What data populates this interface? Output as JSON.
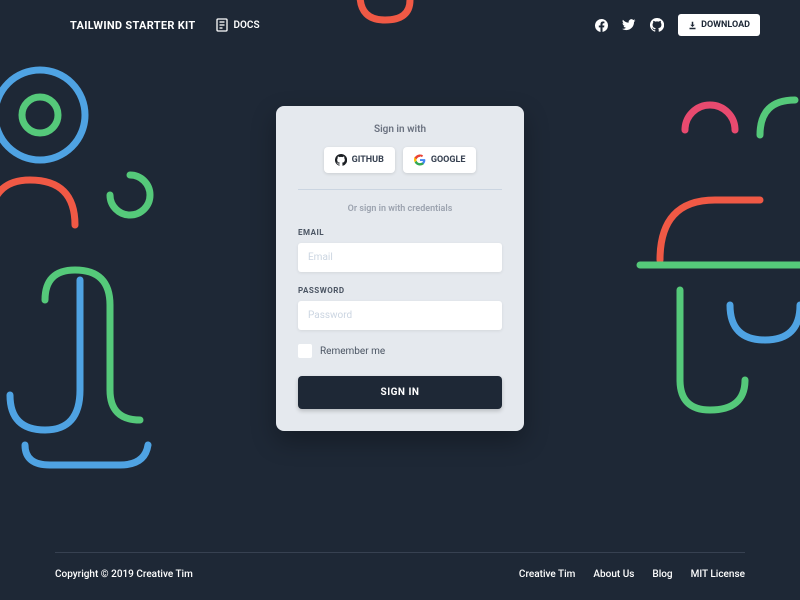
{
  "nav": {
    "brand": "TAILWIND STARTER KIT",
    "docs": "DOCS",
    "download": "DOWNLOAD"
  },
  "card": {
    "signin_with": "Sign in with",
    "github_btn": "GITHUB",
    "google_btn": "GOOGLE",
    "or_text": "Or sign in with credentials",
    "email_label": "EMAIL",
    "email_placeholder": "Email",
    "password_label": "PASSWORD",
    "password_placeholder": "Password",
    "remember_label": "Remember me",
    "signin_btn": "SIGN IN"
  },
  "footer": {
    "copyright": "Copyright © 2019 Creative Tim",
    "links": [
      "Creative Tim",
      "About Us",
      "Blog",
      "MIT License"
    ]
  }
}
